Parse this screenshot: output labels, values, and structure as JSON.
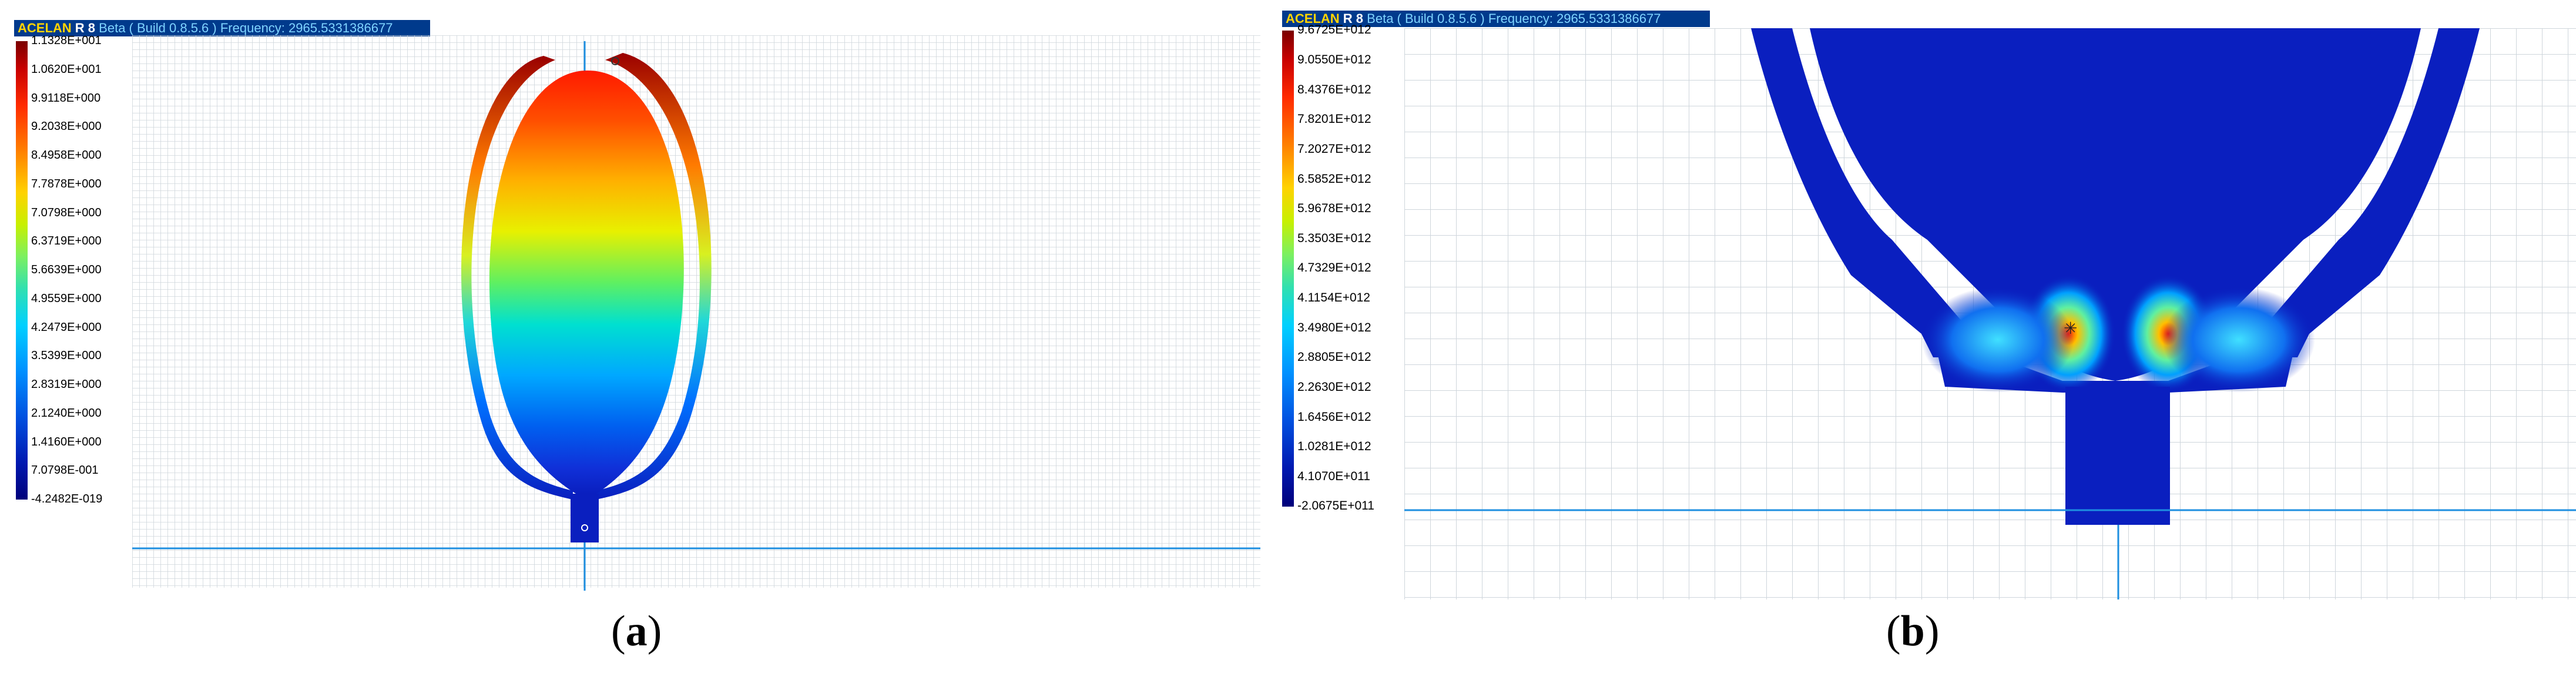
{
  "panels": [
    {
      "id": "a",
      "title": {
        "app": "ACELAN",
        "release": "R 8",
        "build": "Beta ( Build 0.8.5.6 )",
        "frequency": "Frequency: 2965.5331386677"
      },
      "legend_labels": [
        "1.1328E+001",
        "1.0620E+001",
        "9.9118E+000",
        "9.2038E+000",
        "8.4958E+000",
        "7.7878E+000",
        "7.0798E+000",
        "6.3719E+000",
        "5.6639E+000",
        "4.9559E+000",
        "4.2479E+000",
        "3.5399E+000",
        "2.8319E+000",
        "2.1240E+000",
        "1.4160E+000",
        "7.0798E-001",
        "-4.2482E-019"
      ],
      "caption_letter": "a"
    },
    {
      "id": "b",
      "title": {
        "app": "ACELAN",
        "release": "R 8",
        "build": "Beta ( Build 0.8.5.6 )",
        "frequency": "Frequency: 2965.5331386677"
      },
      "legend_labels": [
        "9.6725E+012",
        "9.0550E+012",
        "8.4376E+012",
        "7.8201E+012",
        "7.2027E+012",
        "6.5852E+012",
        "5.9678E+012",
        "5.3503E+012",
        "4.7329E+012",
        "4.1154E+012",
        "3.4980E+012",
        "2.8805E+012",
        "2.2630E+012",
        "1.6456E+012",
        "1.0281E+012",
        "4.1070E+011",
        "-2.0675E+011"
      ],
      "caption_letter": "b"
    }
  ],
  "colors": {
    "title_bg": "#003a8c",
    "grid_line": "#cfd6dc",
    "axis_line": "#1e8fe0",
    "shape_blue": "#0a1fbf"
  }
}
